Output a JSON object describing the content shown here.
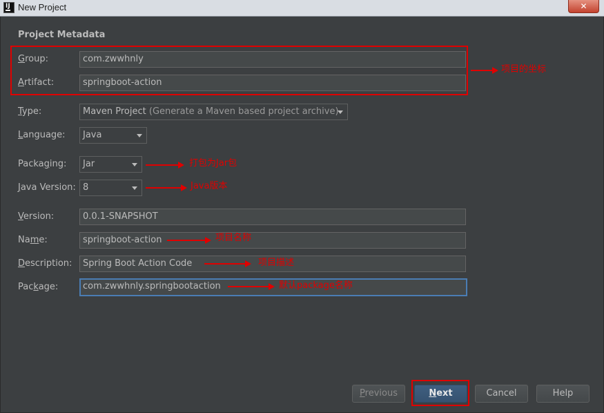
{
  "window": {
    "title": "New Project",
    "close_glyph": "✕",
    "app_icon": "IJ"
  },
  "section": {
    "title": "Project Metadata"
  },
  "fields": {
    "group": {
      "mnemonic": "G",
      "label_rest": "roup:",
      "value": "com.zwwhnly"
    },
    "artifact": {
      "mnemonic": "A",
      "label_rest": "rtifact:",
      "value": "springboot-action"
    },
    "type": {
      "mnemonic": "T",
      "label_rest": "ype:",
      "value": "Maven Project",
      "hint": "(Generate a Maven based project archive)"
    },
    "language": {
      "mnemonic": "L",
      "label_rest": "anguage:",
      "value": "Java"
    },
    "packaging": {
      "label_pre": "Packa",
      "mnemonic": "g",
      "label_post": "ing:",
      "value": "Jar"
    },
    "java_version": {
      "mnemonic": "J",
      "label_rest": "ava Version:",
      "value": "8"
    },
    "version": {
      "mnemonic": "V",
      "label_rest": "ersion:",
      "value": "0.0.1-SNAPSHOT"
    },
    "name": {
      "label_pre": "Na",
      "mnemonic": "m",
      "label_post": "e:",
      "value": "springboot-action"
    },
    "description": {
      "mnemonic": "D",
      "label_rest": "escription:",
      "value": "Spring Boot Action Code"
    },
    "package": {
      "label_pre": "Pac",
      "mnemonic": "k",
      "label_post": "age:",
      "value": "com.zwwhnly.springbootaction"
    }
  },
  "annotations": {
    "coordinates": "项目的坐标",
    "packaging": "打包为Jar包",
    "java_version": "Java版本",
    "name": "项目名称",
    "description": "项目描述",
    "package": "默认package名称",
    "accent_color": "#e00000"
  },
  "buttons": {
    "previous": {
      "mnemonic": "P",
      "label_rest": "revious"
    },
    "next": {
      "mnemonic": "N",
      "label_rest": "ext"
    },
    "cancel": {
      "label": "Cancel"
    },
    "help": {
      "label": "Help"
    }
  },
  "colors": {
    "background": "#3c3f41",
    "field_bg": "#45494a",
    "focus_border": "#4a7db4",
    "primary_button": "#365270"
  }
}
